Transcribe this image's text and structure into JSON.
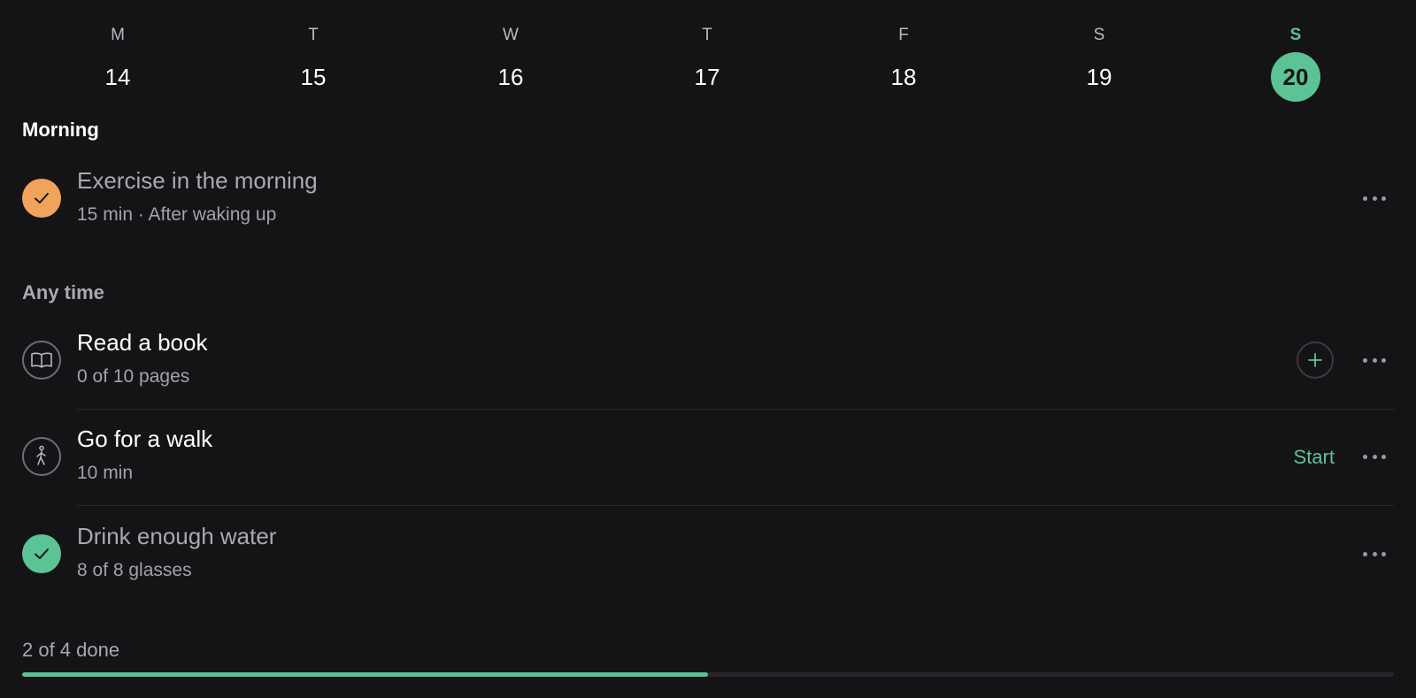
{
  "week": {
    "days": [
      {
        "letter": "M",
        "number": "14",
        "selected": false
      },
      {
        "letter": "T",
        "number": "15",
        "selected": false
      },
      {
        "letter": "W",
        "number": "16",
        "selected": false
      },
      {
        "letter": "T",
        "number": "17",
        "selected": false
      },
      {
        "letter": "F",
        "number": "18",
        "selected": false
      },
      {
        "letter": "S",
        "number": "19",
        "selected": false
      },
      {
        "letter": "S",
        "number": "20",
        "selected": true
      }
    ]
  },
  "sections": {
    "morning": {
      "title": "Morning",
      "habits": [
        {
          "title": "Exercise in the morning",
          "subtitle": "15 min · After waking up",
          "icon": "check-icon",
          "status": "done"
        }
      ]
    },
    "anytime": {
      "title": "Any time",
      "habits": [
        {
          "title": "Read a book",
          "subtitle": "0 of 10 pages",
          "icon": "book-icon",
          "status": "pending",
          "action": "add"
        },
        {
          "title": "Go for a walk",
          "subtitle": "10 min",
          "icon": "walking-icon",
          "status": "pending",
          "action_label": "Start"
        },
        {
          "title": "Drink enough water",
          "subtitle": "8 of 8 glasses",
          "icon": "check-icon",
          "status": "done"
        }
      ]
    }
  },
  "progress": {
    "label": "2 of 4 done",
    "done": 2,
    "total": 4
  },
  "colors": {
    "accent_green": "#5cc395",
    "accent_orange": "#f1a35b",
    "background": "#141416"
  }
}
